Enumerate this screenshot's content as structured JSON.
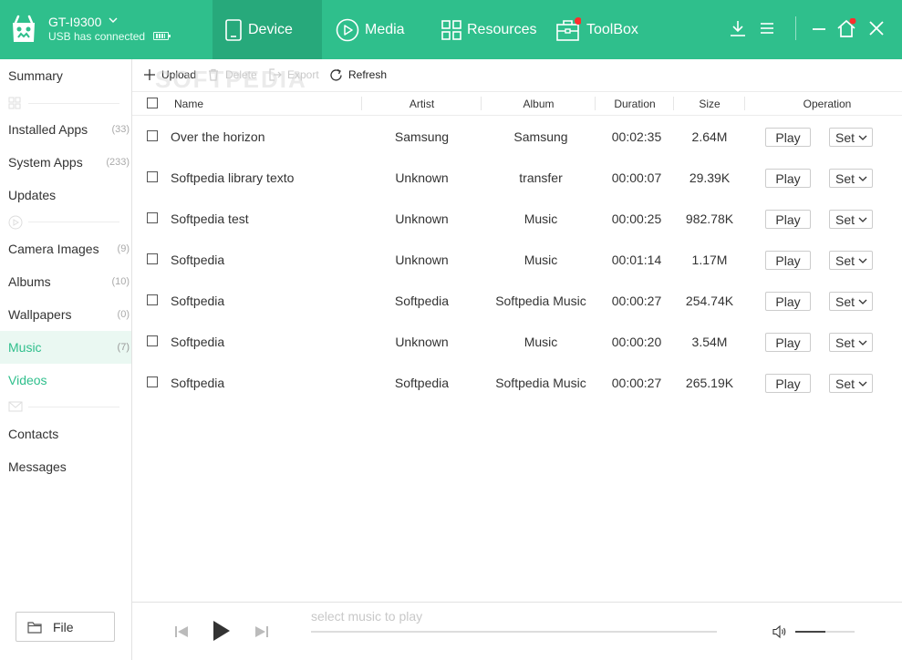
{
  "device": {
    "name": "GT-I9300",
    "status": "USB has connected"
  },
  "nav": {
    "tabs": [
      {
        "label": "Device",
        "icon": "phone-icon",
        "active": true
      },
      {
        "label": "Media",
        "icon": "play-circle-icon",
        "active": false
      },
      {
        "label": "Resources",
        "icon": "grid-icon",
        "active": false
      },
      {
        "label": "ToolBox",
        "icon": "toolbox-icon",
        "active": false,
        "badge": true
      }
    ]
  },
  "window_controls": [
    "download-icon",
    "menu-icon",
    "minimize-icon",
    "home-icon",
    "close-icon"
  ],
  "sidebar": {
    "items": [
      {
        "label": "Summary",
        "count": ""
      },
      {
        "label": "Installed Apps",
        "count": "(33)"
      },
      {
        "label": "System Apps",
        "count": "(233)"
      },
      {
        "label": "Updates",
        "count": ""
      },
      {
        "label": "Camera Images",
        "count": "(9)"
      },
      {
        "label": "Albums",
        "count": "(10)"
      },
      {
        "label": "Wallpapers",
        "count": "(0)"
      },
      {
        "label": "Music",
        "count": "(7)"
      },
      {
        "label": "Videos",
        "count": ""
      },
      {
        "label": "Contacts",
        "count": ""
      },
      {
        "label": "Messages",
        "count": ""
      }
    ],
    "file_button": "File"
  },
  "toolbar": {
    "upload": "Upload",
    "delete": "Delete",
    "export": "Export",
    "refresh": "Refresh",
    "watermark": "SOFTPEDIA"
  },
  "table": {
    "headers": {
      "name": "Name",
      "artist": "Artist",
      "album": "Album",
      "duration": "Duration",
      "size": "Size",
      "operation": "Operation"
    },
    "play_label": "Play",
    "set_label": "Set",
    "rows": [
      {
        "name": "Over the horizon",
        "artist": "Samsung",
        "album": "Samsung",
        "duration": "00:02:35",
        "size": "2.64M"
      },
      {
        "name": "Softpedia library texto",
        "artist": "Unknown",
        "album": "transfer",
        "duration": "00:00:07",
        "size": "29.39K"
      },
      {
        "name": "Softpedia test",
        "artist": "Unknown",
        "album": "Music",
        "duration": "00:00:25",
        "size": "982.78K"
      },
      {
        "name": "Softpedia",
        "artist": "Unknown",
        "album": "Music",
        "duration": "00:01:14",
        "size": "1.17M"
      },
      {
        "name": "Softpedia",
        "artist": "Softpedia",
        "album": "Softpedia Music",
        "duration": "00:00:27",
        "size": "254.74K"
      },
      {
        "name": "Softpedia",
        "artist": "Unknown",
        "album": "Music",
        "duration": "00:00:20",
        "size": "3.54M"
      },
      {
        "name": "Softpedia",
        "artist": "Softpedia",
        "album": "Softpedia Music",
        "duration": "00:00:27",
        "size": "265.19K"
      }
    ]
  },
  "player": {
    "hint": "select music to play",
    "volume_fraction": 0.5
  },
  "colors": {
    "accent": "#2fbf8c",
    "accent_dark": "#27a97b",
    "badge": "#ff2d2d"
  }
}
